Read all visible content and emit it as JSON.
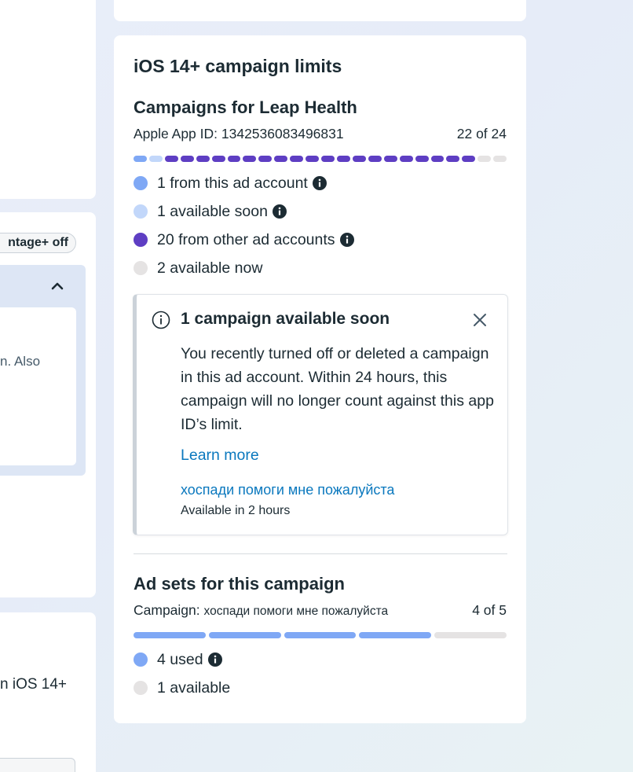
{
  "left_column": {
    "advantage_pill": "ntage+ off",
    "accordion_text": "n. Also",
    "ios_text": "n iOS 14+"
  },
  "card": {
    "title": "iOS 14+ campaign limits",
    "campaigns": {
      "title": "Campaigns for Leap Health",
      "app_id": "Apple App ID: 1342536083496831",
      "count": "22 of 24",
      "bar": {
        "from_this_account": 1,
        "available_soon": 1,
        "from_other_accounts": 20,
        "available_now": 2
      },
      "legend": [
        {
          "label": "1 from this ad account",
          "color": "#7fa8f5",
          "info": true
        },
        {
          "label": "1 available soon",
          "color": "#c2d7fa",
          "info": true
        },
        {
          "label": "20 from other ad accounts",
          "color": "#5e3ec3",
          "info": true
        },
        {
          "label": "2 available now",
          "color": "#e5e3e3",
          "info": false
        }
      ]
    },
    "notice": {
      "icon": "info-circle-icon",
      "title": "1 campaign available soon",
      "body": "You recently turned off or deleted a campaign in this ad account. Within 24 hours, this campaign will no longer count against this app ID’s limit.",
      "link": "Learn more",
      "campaign_name": "хоспади помоги мне пожалуйста",
      "availability": "Available in 2 hours"
    },
    "ad_sets": {
      "title": "Ad sets for this campaign",
      "campaign_label": "Campaign:",
      "campaign_name": "хоспади помоги мне пожалуйста",
      "count": "4 of 5",
      "bar": {
        "used": 4,
        "available": 1
      },
      "legend": [
        {
          "label": "4 used",
          "color": "#7fa8f5",
          "info": true
        },
        {
          "label": "1 available",
          "color": "#e5e3e3",
          "info": false
        }
      ]
    }
  },
  "colors": {
    "from_this_account": "#7fa8f5",
    "available_soon": "#c2d7fa",
    "from_other_accounts": "#5e3ec3",
    "available": "#e5e3e3",
    "link": "#0a78be"
  }
}
